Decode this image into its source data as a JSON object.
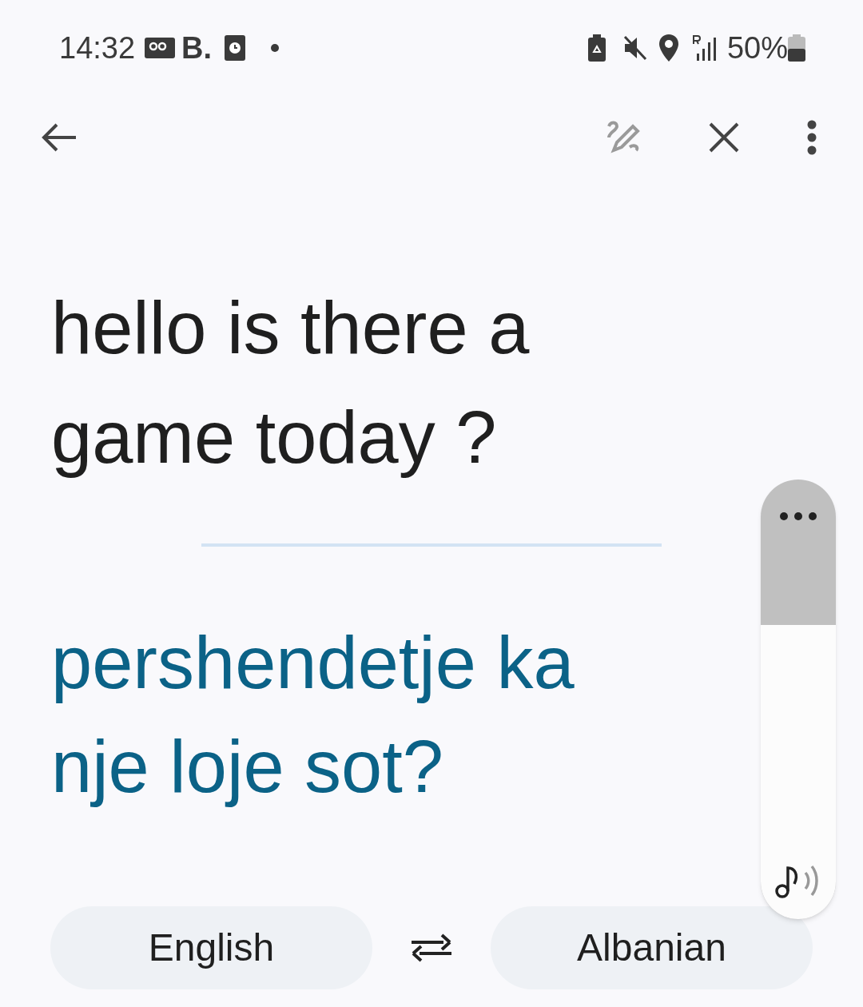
{
  "status_bar": {
    "time": "14:32",
    "carrier": "B.",
    "battery": "50%"
  },
  "source_text": "hello is there a game today ?",
  "translation": "pershendetje ka nje loje sot?",
  "volume_panel": {
    "level": 0.67
  },
  "languages": {
    "source": "English",
    "target": "Albanian"
  }
}
